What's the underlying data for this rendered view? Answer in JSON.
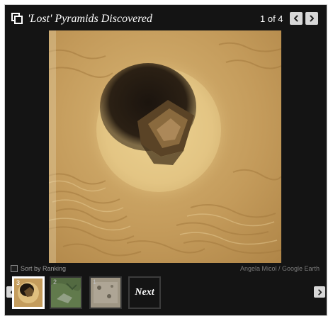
{
  "header": {
    "title": "'Lost' Pyramids Discovered",
    "counter": "1 of 4",
    "prev_icon": "chevron-left-icon",
    "next_icon": "chevron-right-icon",
    "gallery_icon": "gallery-icon"
  },
  "photo": {
    "credit": "Angela Micol / Google Earth"
  },
  "controls": {
    "sort_label": "Sort by Ranking",
    "sort_checked": false
  },
  "thumbnails": [
    {
      "number": "3",
      "selected": true
    },
    {
      "number": "2",
      "selected": false
    },
    {
      "number": "1",
      "selected": false
    }
  ],
  "next_label": "Next",
  "colors": {
    "background": "#141414",
    "button": "#d8d8d8",
    "sand": "#c8a365"
  }
}
